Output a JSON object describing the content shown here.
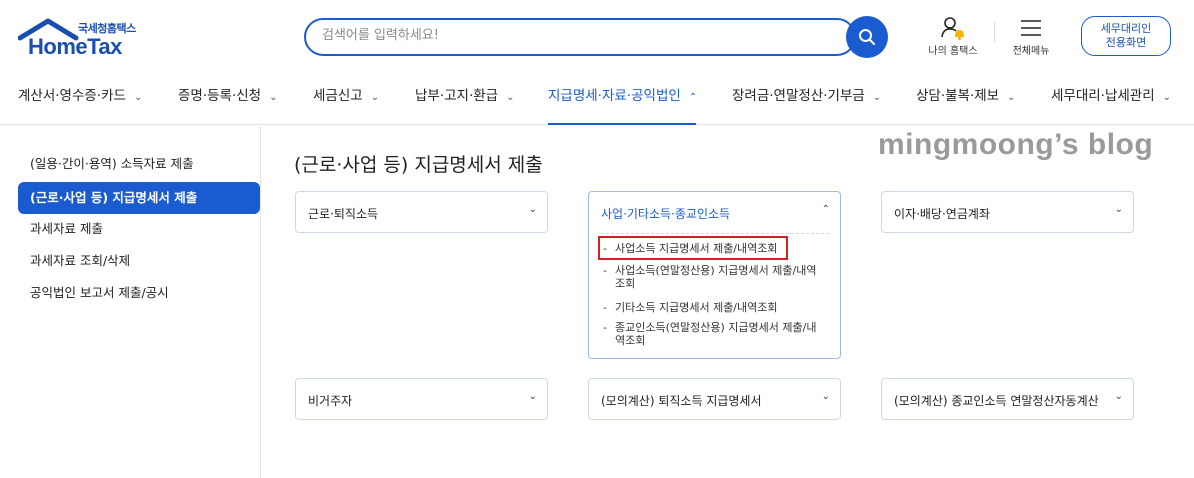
{
  "header": {
    "logo_sub": "국세청홈택스",
    "logo_main": "HomeTax",
    "search_placeholder": "검색어를 입력하세요!",
    "my_hometax": "나의 홈택스",
    "all_menu": "전체메뉴",
    "agent_line1": "세무대리인",
    "agent_line2": "전용화면"
  },
  "gnb": [
    {
      "label": "계산서·영수증·카드",
      "chevron": "⌄"
    },
    {
      "label": "증명·등록·신청",
      "chevron": "⌄"
    },
    {
      "label": "세금신고",
      "chevron": "⌄"
    },
    {
      "label": "납부·고지·환급",
      "chevron": "⌄"
    },
    {
      "label": "지급명세·자료·공익법인",
      "chevron": "⌃"
    },
    {
      "label": "장려금·연말정산·기부금",
      "chevron": "⌄"
    },
    {
      "label": "상담·불복·제보",
      "chevron": "⌄"
    },
    {
      "label": "세무대리·납세관리",
      "chevron": "⌄"
    }
  ],
  "sidebar": [
    {
      "label": "(일용·간이·용역) 소득자료 제출"
    },
    {
      "label": "(근로·사업 등) 지급명세서 제출"
    },
    {
      "label": "과세자료 제출"
    },
    {
      "label": "과세자료 조회/삭제"
    },
    {
      "label": "공익법인 보고서 제출/공시"
    }
  ],
  "main": {
    "title": "(근로·사업 등) 지급명세서 제출",
    "watermark": "mingmoong’s blog",
    "cards": [
      {
        "label": "근로·퇴직소득"
      },
      {
        "label": "사업·기타소득·종교인소득"
      },
      {
        "label": "이자·배당·연금계좌"
      },
      {
        "label": "비거주자"
      },
      {
        "label": "(모의계산) 퇴직소득 지급명세서"
      },
      {
        "label": "(모의계산) 종교인소득 연말정산자동계산"
      }
    ],
    "sub_items": [
      {
        "dash": "-",
        "line1": "사업소득 지급명세서 제출/내역조회",
        "line2": ""
      },
      {
        "dash": "-",
        "line1": "사업소득(연말정산용) 지급명세서 제출/내역",
        "line2": "조회"
      },
      {
        "dash": "-",
        "line1": "기타소득 지급명세서 제출/내역조회",
        "line2": ""
      },
      {
        "dash": "-",
        "line1": "종교인소득(연말정산용) 지급명세서 제출/내",
        "line2": "역조회"
      }
    ],
    "chev_down": "⌄",
    "chev_up": "⌃"
  },
  "colors": {
    "brand": "#1a5bd0",
    "highlight": "#d32020"
  }
}
